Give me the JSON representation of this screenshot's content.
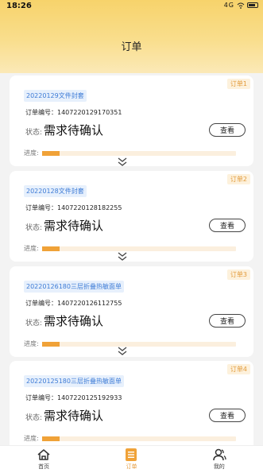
{
  "status_bar": {
    "time": "18:26",
    "signal": "4G",
    "wifi": "wifi",
    "battery": "battery"
  },
  "header": {
    "title": "订单"
  },
  "orders": [
    {
      "tag": "订单1",
      "name": "20220129文件封套",
      "order_no_label": "订单编号：",
      "order_no": "1407220129170351",
      "status_label": "状态:",
      "status": "需求待确认",
      "button": "查看",
      "progress_label": "进度:",
      "progress": 0.09
    },
    {
      "tag": "订单2",
      "name": "20220128文件封套",
      "order_no_label": "订单编号：",
      "order_no": "1407220128182255",
      "status_label": "状态:",
      "status": "需求待确认",
      "button": "查看",
      "progress_label": "进度:",
      "progress": 0.09
    },
    {
      "tag": "订单3",
      "name": "20220126180三层折叠热敏面单",
      "order_no_label": "订单编号：",
      "order_no": "1407220126112755",
      "status_label": "状态:",
      "status": "需求待确认",
      "button": "查看",
      "progress_label": "进度:",
      "progress": 0.09
    },
    {
      "tag": "订单4",
      "name": "20220125180三层折叠热敏面单",
      "order_no_label": "订单编号：",
      "order_no": "1407220125192933",
      "status_label": "状态:",
      "status": "需求待确认",
      "button": "查看",
      "progress_label": "进度:",
      "progress": 0.09
    }
  ],
  "tabbar": {
    "items": [
      {
        "label": "首页",
        "icon": "home-icon"
      },
      {
        "label": "订单",
        "icon": "order-list-icon",
        "active": true
      },
      {
        "label": "我的",
        "icon": "user-icon"
      }
    ]
  },
  "colors": {
    "accent": "#f0a238",
    "tag_blue": "#3d7bd6",
    "header": "#f7d36b"
  }
}
